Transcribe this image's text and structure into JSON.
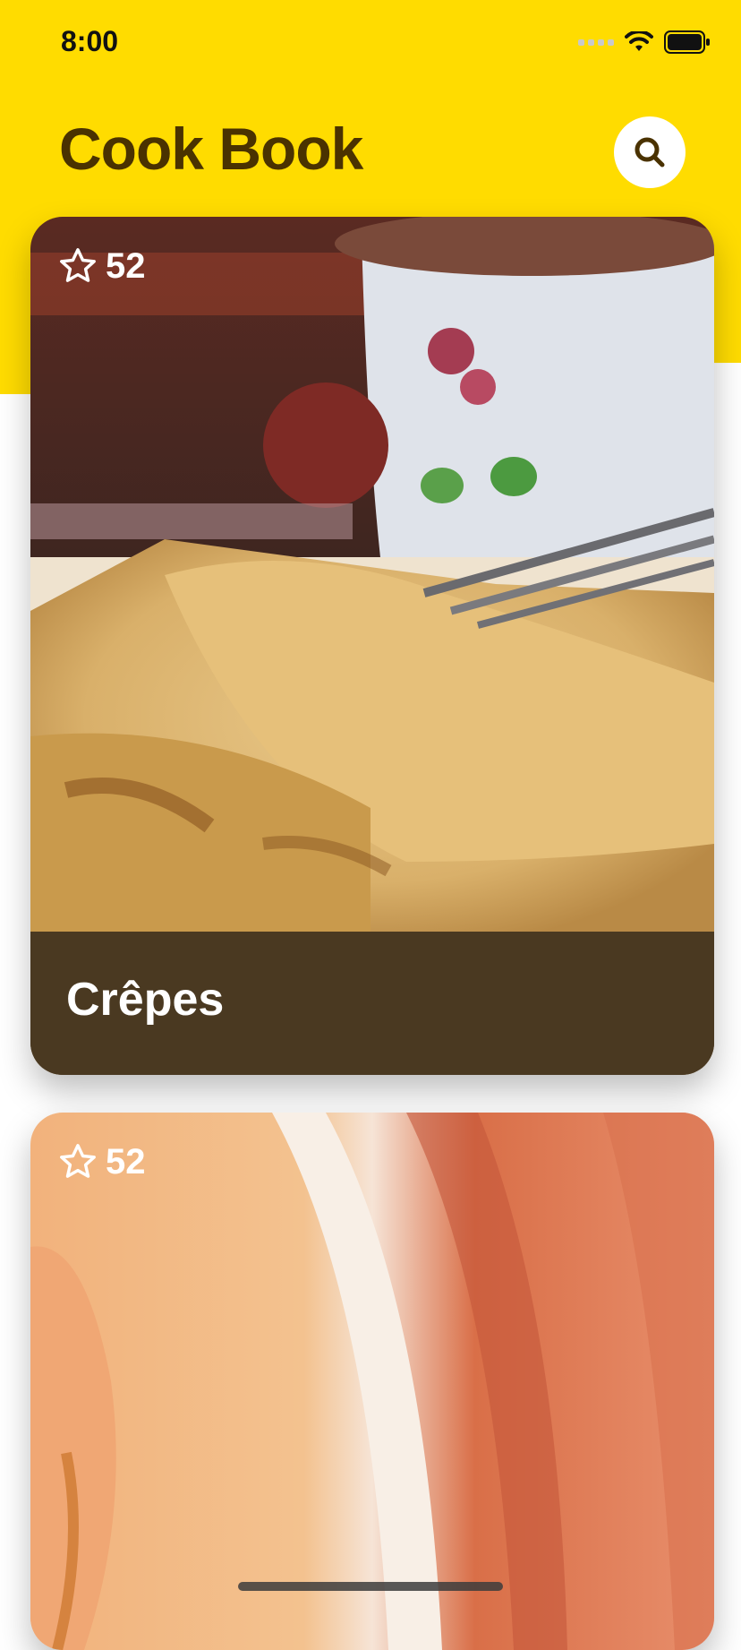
{
  "status": {
    "time": "8:00"
  },
  "header": {
    "title": "Cook Book",
    "search_icon": "search-icon"
  },
  "recipes": [
    {
      "name": "Crêpes",
      "stars": "52",
      "star_icon": "star-outline-icon"
    },
    {
      "name": "",
      "stars": "52",
      "star_icon": "star-outline-icon"
    }
  ],
  "colors": {
    "accent": "#FFDC00",
    "title": "#4A3200",
    "caption_bg": "#4A3A22"
  }
}
